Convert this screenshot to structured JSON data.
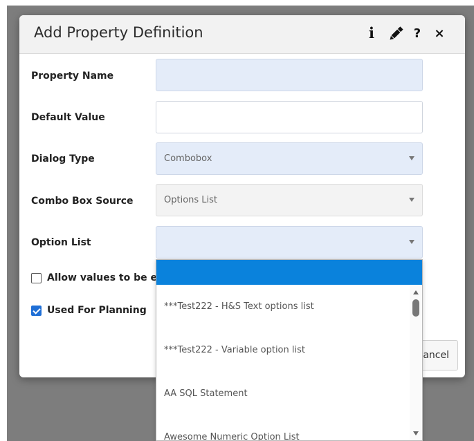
{
  "dialog": {
    "title": "Add Property Definition",
    "header_icons": [
      "info-icon",
      "pencil-icon",
      "help-icon",
      "close-icon"
    ],
    "info_glyph": "i",
    "help_glyph": "?",
    "close_glyph": "×"
  },
  "form": {
    "property_name": {
      "label": "Property Name",
      "value": ""
    },
    "default_value": {
      "label": "Default Value",
      "value": ""
    },
    "dialog_type": {
      "label": "Dialog Type",
      "value": "Combobox"
    },
    "combo_box_source": {
      "label": "Combo Box Source",
      "value": "Options List"
    },
    "option_list": {
      "label": "Option List",
      "value": ""
    }
  },
  "checkboxes": {
    "allow_values": {
      "label": "Allow values to be er",
      "checked": false
    },
    "used_for_planning": {
      "label": "Used For Planning",
      "checked": true
    }
  },
  "buttons": {
    "cancel_label": "ancel"
  },
  "option_dropdown": {
    "selected_label": "",
    "items": [
      "***Test222 - H&S Text options list",
      "***Test222 - Variable option list",
      "AA SQL Statement",
      "Awesome Numeric Option List"
    ]
  },
  "colors": {
    "accent": "#0a82dc",
    "checkbox_checked": "#1f6fd6",
    "required_field_bg": "#e4ecf9",
    "disabled_field_bg": "#f3f3f3"
  }
}
